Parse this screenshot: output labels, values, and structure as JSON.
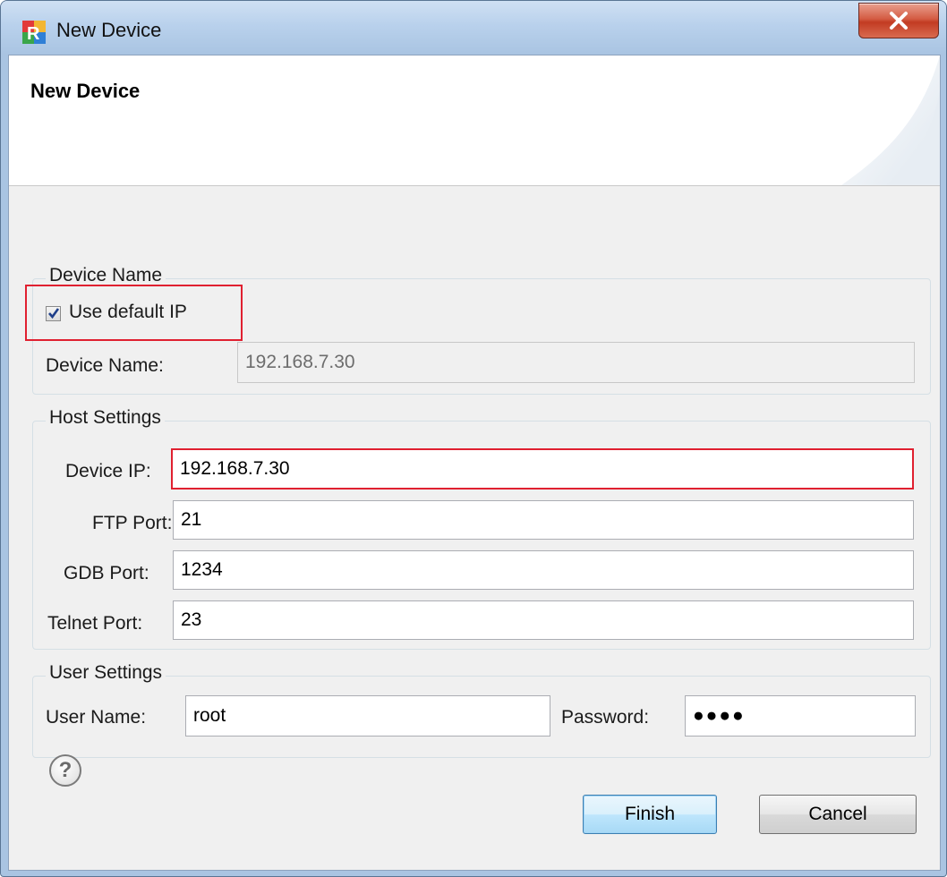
{
  "window": {
    "title": "New Device",
    "app_icon": "r-logo-icon",
    "close_icon": "close-icon"
  },
  "banner": {
    "title": "New Device"
  },
  "device_name_group": {
    "legend": "Device Name",
    "use_default_ip_label": "Use default IP",
    "use_default_ip_checked": true,
    "device_name_label": "Device Name:",
    "device_name_value": "192.168.7.30"
  },
  "host_settings": {
    "legend": "Host Settings",
    "device_ip_label": "Device IP:",
    "device_ip_value": "192.168.7.30",
    "ftp_port_label": "FTP Port:",
    "ftp_port_value": "21",
    "gdb_port_label": "GDB Port:",
    "gdb_port_value": "1234",
    "telnet_port_label": "Telnet Port:",
    "telnet_port_value": "23"
  },
  "user_settings": {
    "legend": "User Settings",
    "user_name_label": "User Name:",
    "user_name_value": "root",
    "password_label": "Password:",
    "password_value": "●●●●"
  },
  "footer": {
    "help_symbol": "?",
    "finish_label": "Finish",
    "cancel_label": "Cancel"
  },
  "colors": {
    "highlight": "#e02030",
    "title_bar": "#b9d1ec",
    "close_button": "#c23b22"
  }
}
